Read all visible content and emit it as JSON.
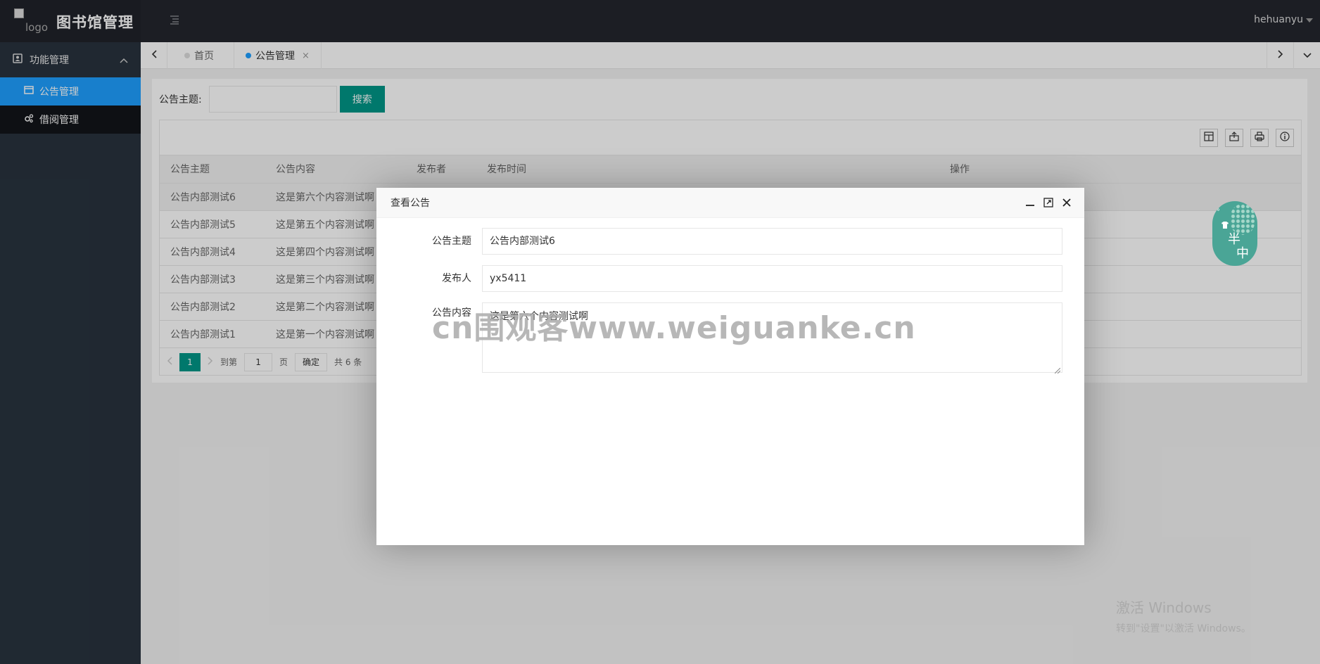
{
  "header": {
    "logo_alt": "logo",
    "title": "图书馆管理",
    "user": "hehuanyu"
  },
  "sidebar": {
    "group_label": "功能管理",
    "items": [
      {
        "label": "公告管理",
        "active": true
      },
      {
        "label": "借阅管理",
        "active": false
      }
    ]
  },
  "tabs": [
    {
      "label": "首页",
      "active": false
    },
    {
      "label": "公告管理",
      "active": true,
      "close": "×"
    }
  ],
  "search": {
    "label": "公告主题:",
    "button": "搜索"
  },
  "table": {
    "columns": [
      "公告主题",
      "公告内容",
      "发布者",
      "发布时间",
      "操作"
    ],
    "rows": [
      {
        "title": "公告内部测试6",
        "content": "这是第六个内容测试啊"
      },
      {
        "title": "公告内部测试5",
        "content": "这是第五个内容测试啊"
      },
      {
        "title": "公告内部测试4",
        "content": "这是第四个内容测试啊"
      },
      {
        "title": "公告内部测试3",
        "content": "这是第三个内容测试啊"
      },
      {
        "title": "公告内部测试2",
        "content": "这是第二个内容测试啊"
      },
      {
        "title": "公告内部测试1",
        "content": "这是第一个内容测试啊"
      }
    ]
  },
  "pager": {
    "current": "1",
    "goto_label": "到第",
    "goto_value": "1",
    "page_unit": "页",
    "confirm": "确定",
    "total": "共 6 条"
  },
  "dialog": {
    "title": "查看公告",
    "fields": {
      "title_label": "公告主题",
      "title_value": "公告内部测试6",
      "publisher_label": "发布人",
      "publisher_value": "yx5411",
      "content_label": "公告内容",
      "content_value": "这是第六个内容测试啊"
    }
  },
  "watermark": "cn围观客www.weiguanke.cn",
  "sticker": {
    "deg": "°",
    "t1": "半",
    "t2": "中"
  },
  "activation": {
    "line1": "激活 Windows",
    "line2": "转到\"设置\"以激活 Windows。"
  },
  "colors": {
    "header_bg": "#23262e",
    "sidebar_bg": "#28333e",
    "active_blue": "#1e9fff",
    "primary_green": "#009688"
  }
}
